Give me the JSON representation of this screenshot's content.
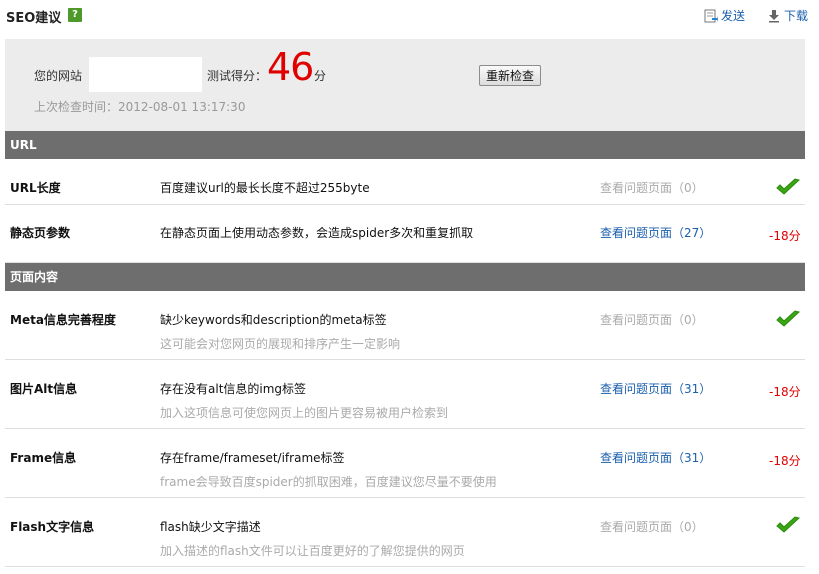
{
  "header": {
    "title": "SEO建议",
    "help": "?",
    "send_label": "发送",
    "download_label": "下载"
  },
  "summary": {
    "site_label": "您的网站",
    "site_value": "",
    "score_label": "测试得分：",
    "score": "46",
    "score_unit": "分",
    "recheck_label": "重新检查",
    "last_check": "上次检查时间：2012-08-01 13:17:30"
  },
  "sections": [
    {
      "title": "URL",
      "items": [
        {
          "name": "URL长度",
          "desc": "百度建议url的最长长度不超过255byte",
          "sub": "",
          "link": "查看问题页面（0）",
          "status": "pass",
          "penalty": ""
        },
        {
          "name": "静态页参数",
          "desc": "在静态页面上使用动态参数，会造成spider多次和重复抓取",
          "sub": "",
          "link": "查看问题页面（27）",
          "status": "fail",
          "penalty": "-18分"
        }
      ]
    },
    {
      "title": "页面内容",
      "items": [
        {
          "name": "Meta信息完善程度",
          "desc": "缺少keywords和description的meta标签",
          "sub": "这可能会对您网页的展现和排序产生一定影响",
          "link": "查看问题页面（0）",
          "status": "pass",
          "penalty": ""
        },
        {
          "name": "图片Alt信息",
          "desc": "存在没有alt信息的img标签",
          "sub": "加入这项信息可使您网页上的图片更容易被用户检索到",
          "link": "查看问题页面（31）",
          "status": "fail",
          "penalty": "-18分"
        },
        {
          "name": "Frame信息",
          "desc": "存在frame/frameset/iframe标签",
          "sub": "frame会导致百度spider的抓取困难，百度建议您尽量不要使用",
          "link": "查看问题页面（31）",
          "status": "fail",
          "penalty": "-18分"
        },
        {
          "name": "Flash文字信息",
          "desc": "flash缺少文字描述",
          "sub": "加入描述的flash文件可以让百度更好的了解您提供的网页",
          "link": "查看问题页面（0）",
          "status": "pass",
          "penalty": ""
        }
      ]
    }
  ],
  "colors": {
    "accent_red": "#e00000",
    "link_blue": "#1b5fad",
    "section_bg": "#6e6e6e",
    "pass_green": "#3aa614"
  }
}
